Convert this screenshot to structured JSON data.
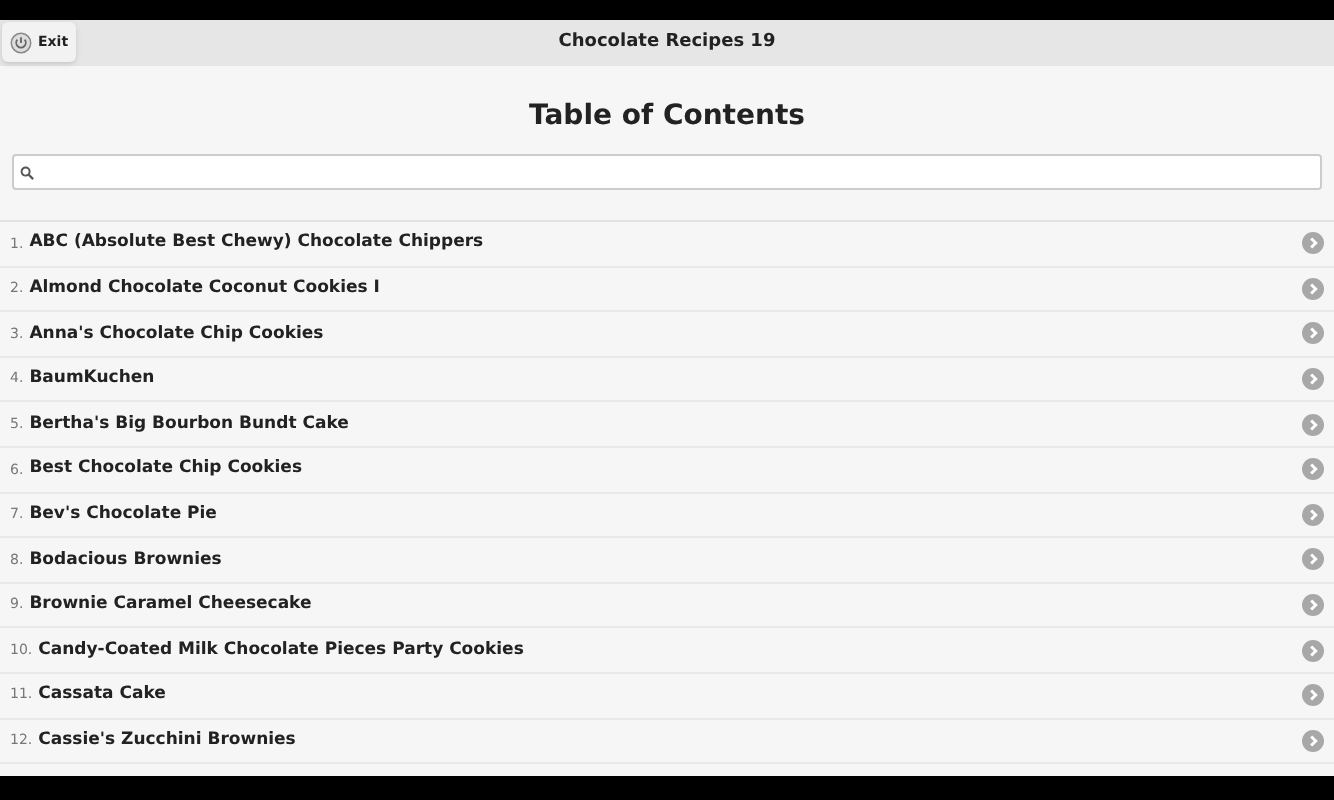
{
  "header": {
    "exit_label": "Exit",
    "title": "Chocolate Recipes 19"
  },
  "page_title": "Table of Contents",
  "recipes": [
    {
      "number": "1.",
      "name": "ABC (Absolute Best Chewy) Chocolate Chippers"
    },
    {
      "number": "2.",
      "name": "Almond Chocolate Coconut Cookies I"
    },
    {
      "number": "3.",
      "name": "Anna's Chocolate Chip Cookies"
    },
    {
      "number": "4.",
      "name": "BaumKuchen"
    },
    {
      "number": "5.",
      "name": "Bertha's Big Bourbon Bundt Cake"
    },
    {
      "number": "6.",
      "name": "Best Chocolate Chip Cookies"
    },
    {
      "number": "7.",
      "name": "Bev's Chocolate Pie"
    },
    {
      "number": "8.",
      "name": "Bodacious Brownies"
    },
    {
      "number": "9.",
      "name": "Brownie Caramel Cheesecake"
    },
    {
      "number": "10.",
      "name": "Candy-Coated Milk Chocolate Pieces Party Cookies"
    },
    {
      "number": "11.",
      "name": "Cassata Cake"
    },
    {
      "number": "12.",
      "name": "Cassie's Zucchini Brownies"
    }
  ]
}
